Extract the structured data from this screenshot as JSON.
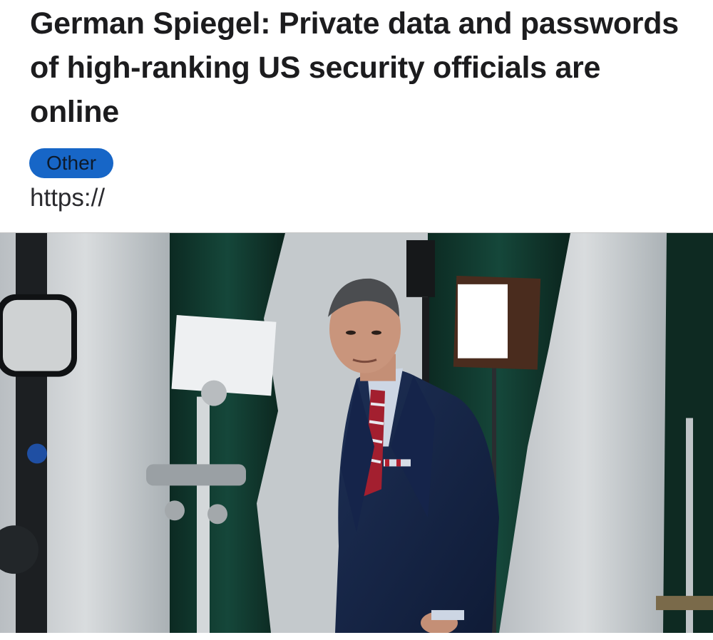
{
  "article": {
    "title": "German Spiegel: Private data and passwords of high-ranking US security officials are online",
    "category": "Other",
    "link_text": "https://",
    "image": {
      "subject": "man in navy suit and striped tie standing in a backstage studio with lights and curtains"
    }
  },
  "colors": {
    "badge_background": "#1766c7",
    "title_text": "#1c1c1e",
    "link_text": "#2a2a2e"
  }
}
